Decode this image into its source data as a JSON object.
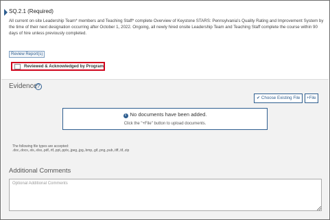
{
  "requirement": {
    "title": "SQ.2.1 (Required)",
    "description": "All current on-site Leadership Team* members and Teaching Staff* complete Overview of Keystone STARS: Pennsylvania's Quality Rating and Improvement System by the time of their next designation occurring after October 1, 2022. Ongoing, all newly hired onsite Leadership Team and Teaching Staff complete the course within 90 days of hire unless previously completed.",
    "review_button": "Review Report(s)",
    "acknowledge_label": "Reviewed & Acknowledged by Program",
    "acknowledge_checked": false
  },
  "evidence": {
    "title": "Evidence",
    "info_icon": "info-icon",
    "choose_button": "✔ Choose Existing File",
    "add_file_button": "+File",
    "no_docs_message": "No documents have been added.",
    "no_docs_icon": "info-icon",
    "upload_hint": "Click the \"+File\" button to upload documents.",
    "file_types_label": "The following file types are accepted:",
    "file_types": ".doc,.docx,.xls,.xlsx,.pdf,.rtf,.ppt,.pptx,.jpeg,.jpg,.bmp,.gif,.png,.pub,.tiff,.tif,.zip"
  },
  "comments": {
    "title": "Additional Comments",
    "placeholder": "Optional Additional Comments",
    "value": ""
  },
  "colors": {
    "accent": "#2d5d8f",
    "highlight_border": "#d0021b",
    "section_background": "#f2f2f2"
  }
}
